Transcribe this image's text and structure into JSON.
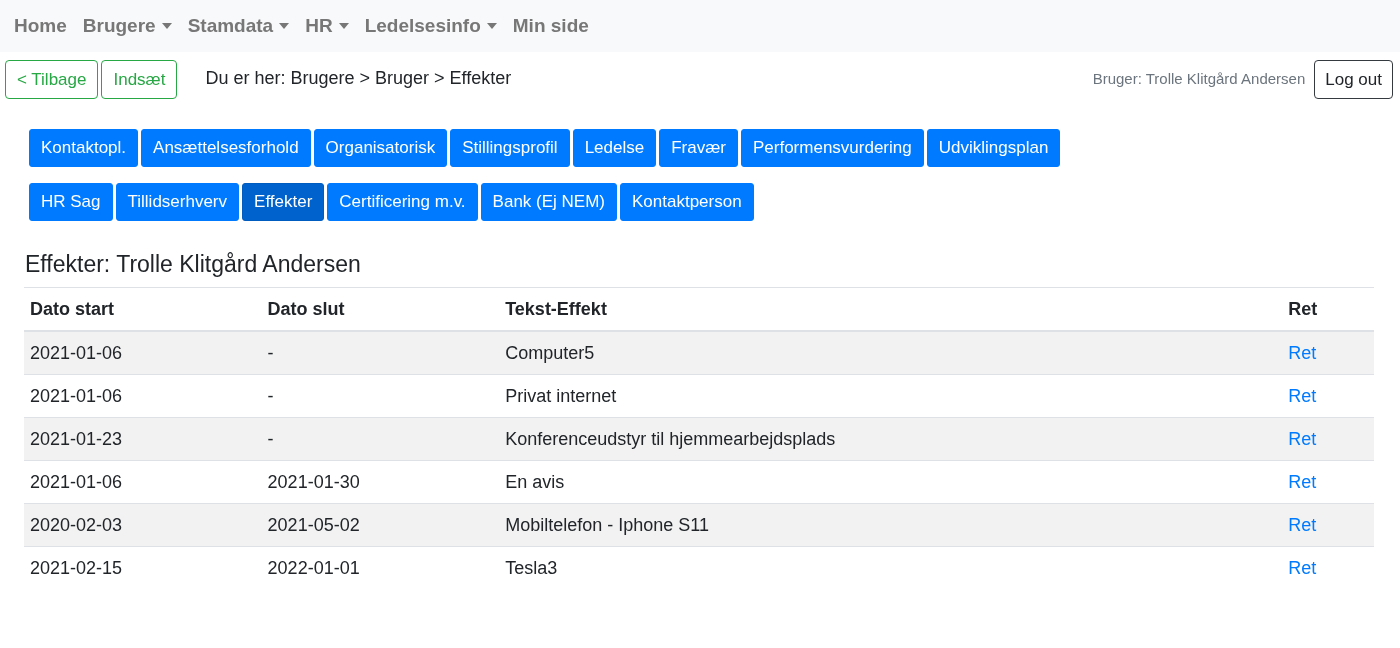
{
  "navbar": {
    "items": [
      {
        "label": "Home",
        "dropdown": false
      },
      {
        "label": "Brugere",
        "dropdown": true
      },
      {
        "label": "Stamdata",
        "dropdown": true
      },
      {
        "label": "HR",
        "dropdown": true
      },
      {
        "label": "Ledelsesinfo",
        "dropdown": true
      },
      {
        "label": "Min side",
        "dropdown": false
      }
    ]
  },
  "toolbar": {
    "buttons": [
      "< Tilbage",
      "Indsæt"
    ],
    "breadcrumb": "Du er her: Brugere > Bruger > Effekter",
    "user": "Bruger: Trolle Klitgård Andersen",
    "logout": "Log out"
  },
  "tab_rows": [
    [
      {
        "label": "Kontaktopl.",
        "selected": false
      },
      {
        "label": "Ansættelsesforhold",
        "selected": false
      },
      {
        "label": "Organisatorisk",
        "selected": false
      },
      {
        "label": "Stillingsprofil",
        "selected": false
      },
      {
        "label": "Ledelse",
        "selected": false
      },
      {
        "label": "Fravær",
        "selected": false
      },
      {
        "label": "Performensvurdering",
        "selected": false
      },
      {
        "label": "Udviklingsplan",
        "selected": false
      }
    ],
    [
      {
        "label": "HR Sag",
        "selected": false
      },
      {
        "label": "Tillidserhverv",
        "selected": false
      },
      {
        "label": "Effekter",
        "selected": true
      },
      {
        "label": "Certificering m.v.",
        "selected": false
      },
      {
        "label": "Bank (Ej NEM)",
        "selected": false
      },
      {
        "label": "Kontaktperson",
        "selected": false
      }
    ]
  ],
  "heading": "Effekter: Trolle Klitgård Andersen",
  "table": {
    "columns": [
      "Dato start",
      "Dato slut",
      "Tekst-Effekt",
      "Ret"
    ],
    "rows": [
      [
        "2021-01-06",
        "-",
        "Computer5",
        "Ret"
      ],
      [
        "2021-01-06",
        "-",
        "Privat internet",
        "Ret"
      ],
      [
        "2021-01-23",
        "-",
        "Konferenceudstyr til hjemmearbejdsplads",
        "Ret"
      ],
      [
        "2021-01-06",
        "2021-01-30",
        "En avis",
        "Ret"
      ],
      [
        "2020-02-03",
        "2021-05-02",
        "Mobiltelefon - Iphone S11",
        "Ret"
      ],
      [
        "2021-02-15",
        "2022-01-01",
        "Tesla3",
        "Ret"
      ]
    ]
  }
}
